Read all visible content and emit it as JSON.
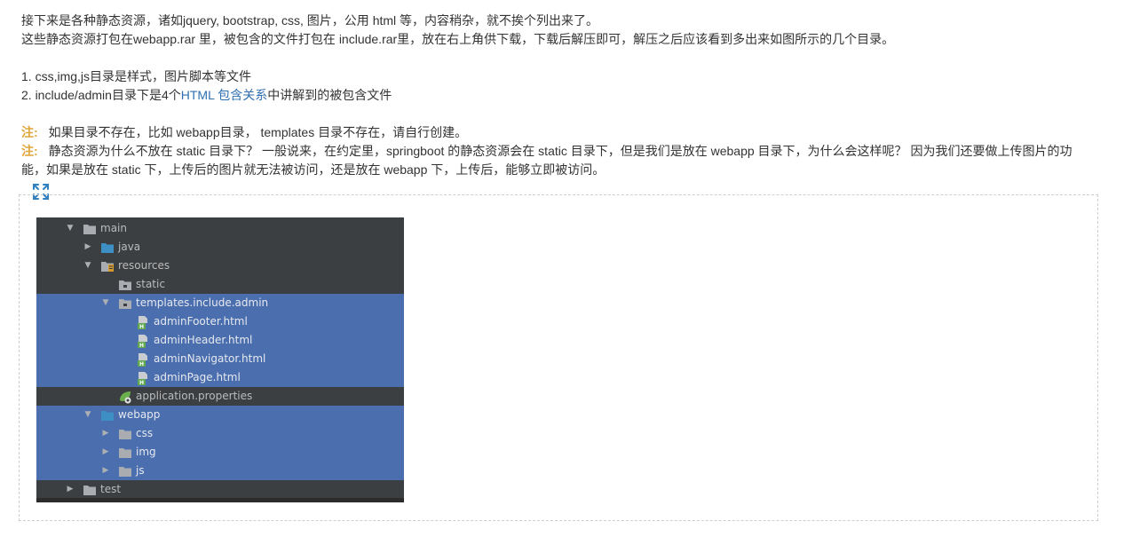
{
  "paragraphs": {
    "intro_line1": "接下来是各种静态资源，诸如jquery, bootstrap, css, 图片，公用 html 等，内容稍杂，就不挨个列出来了。",
    "intro_line2": "这些静态资源打包在webapp.rar 里，被包含的文件打包在 include.rar里，放在右上角供下载，下载后解压即可，解压之后应该看到多出来如图所示的几个目录。",
    "list_item1": "1. css,img,js目录是样式，图片脚本等文件",
    "list_item2_prefix": "2. include/admin目录下是4个",
    "list_item2_link": "HTML 包含关系",
    "list_item2_suffix": "中讲解到的被包含文件"
  },
  "notes": [
    {
      "label": "注:",
      "text": "如果目录不存在，比如 webapp目录， templates 目录不存在，请自行创建。"
    },
    {
      "label": "注:",
      "text": "静态资源为什么不放在 static 目录下？ 一般说来，在约定里，springboot 的静态资源会在 static 目录下，但是我们是放在 webapp 目录下，为什么会这样呢？ 因为我们还要做上传图片的功能，如果是放在 static 下，上传后的图片就无法被访问，还是放在 webapp 下，上传后，能够立即被访问。"
    }
  ],
  "icons": {
    "expand": "expand-icon",
    "folder": "folder-icon",
    "html_file": "html-file-icon",
    "properties_file": "spring-properties-icon"
  },
  "colors": {
    "note_label": "#e0a53a",
    "link": "#2f6fb1",
    "tree_bg": "#3c3f41",
    "tree_selected": "#4b6eaf",
    "folder_java": "#3d8fc4",
    "html_badge": "#5fa84f"
  },
  "tree": [
    {
      "label": "main",
      "depth": 0,
      "arrow": "down",
      "icon": "folder",
      "selected": false
    },
    {
      "label": "java",
      "depth": 1,
      "arrow": "right",
      "icon": "folder-blue",
      "selected": false
    },
    {
      "label": "resources",
      "depth": 1,
      "arrow": "down",
      "icon": "folder-resources",
      "selected": false
    },
    {
      "label": "static",
      "depth": 2,
      "arrow": "",
      "icon": "folder-dot",
      "selected": false
    },
    {
      "label": "templates.include.admin",
      "depth": 2,
      "arrow": "down",
      "icon": "folder-dot",
      "selected": true
    },
    {
      "label": "adminFooter.html",
      "depth": 3,
      "arrow": "",
      "icon": "html",
      "selected": true
    },
    {
      "label": "adminHeader.html",
      "depth": 3,
      "arrow": "",
      "icon": "html",
      "selected": true
    },
    {
      "label": "adminNavigator.html",
      "depth": 3,
      "arrow": "",
      "icon": "html",
      "selected": true
    },
    {
      "label": "adminPage.html",
      "depth": 3,
      "arrow": "",
      "icon": "html",
      "selected": true
    },
    {
      "label": "application.properties",
      "depth": 2,
      "arrow": "",
      "icon": "properties",
      "selected": false
    },
    {
      "label": "webapp",
      "depth": 1,
      "arrow": "down",
      "icon": "folder-blue",
      "selected": true
    },
    {
      "label": "css",
      "depth": 2,
      "arrow": "right",
      "icon": "folder",
      "selected": true
    },
    {
      "label": "img",
      "depth": 2,
      "arrow": "right",
      "icon": "folder",
      "selected": true
    },
    {
      "label": "js",
      "depth": 2,
      "arrow": "right",
      "icon": "folder",
      "selected": true
    },
    {
      "label": "test",
      "depth": 0,
      "arrow": "right",
      "icon": "folder",
      "selected": false
    }
  ]
}
